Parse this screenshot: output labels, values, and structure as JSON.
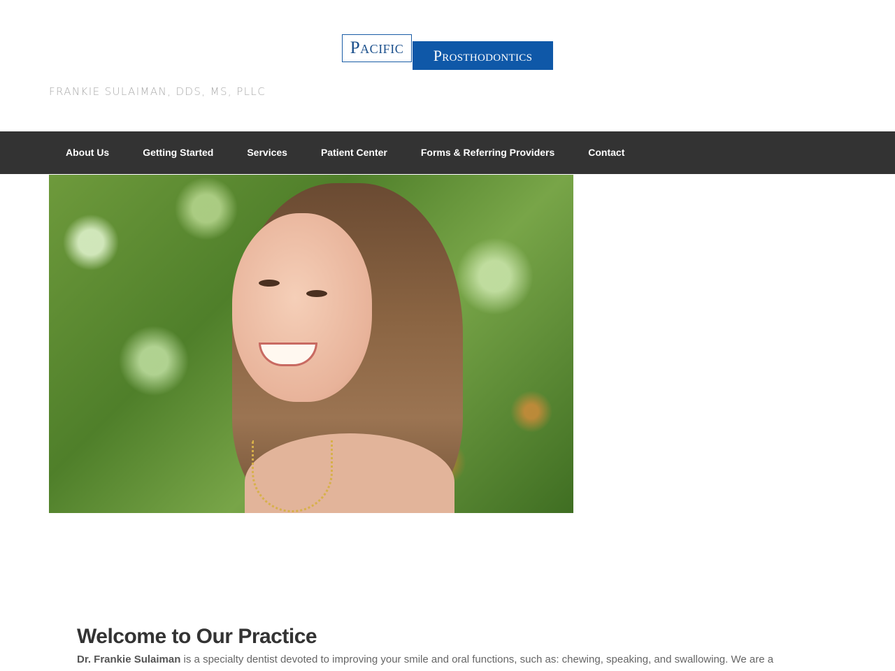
{
  "logo": {
    "word_left": "Pacific",
    "word_right": "Prosthodontics",
    "colors": {
      "blue": "#0f58a8",
      "border": "#1a5ca6"
    }
  },
  "header": {
    "tagline": "FRANKIE SULAIMAN, DDS, MS, PLLC"
  },
  "nav": {
    "items": [
      {
        "label": "About Us"
      },
      {
        "label": "Getting Started"
      },
      {
        "label": "Services"
      },
      {
        "label": "Patient Center"
      },
      {
        "label": "Forms & Referring Providers"
      },
      {
        "label": "Contact"
      }
    ],
    "colors": {
      "background": "#333333",
      "text": "#ffffff"
    }
  },
  "hero": {
    "image": "smiling-woman-photo"
  },
  "welcome": {
    "title": "Welcome to Our Practice",
    "doctor_name": "Dr. Frankie Sulaiman",
    "text": " is a specialty dentist devoted to improving your smile and oral functions, such as: chewing, speaking, and swallowing. We are a"
  }
}
